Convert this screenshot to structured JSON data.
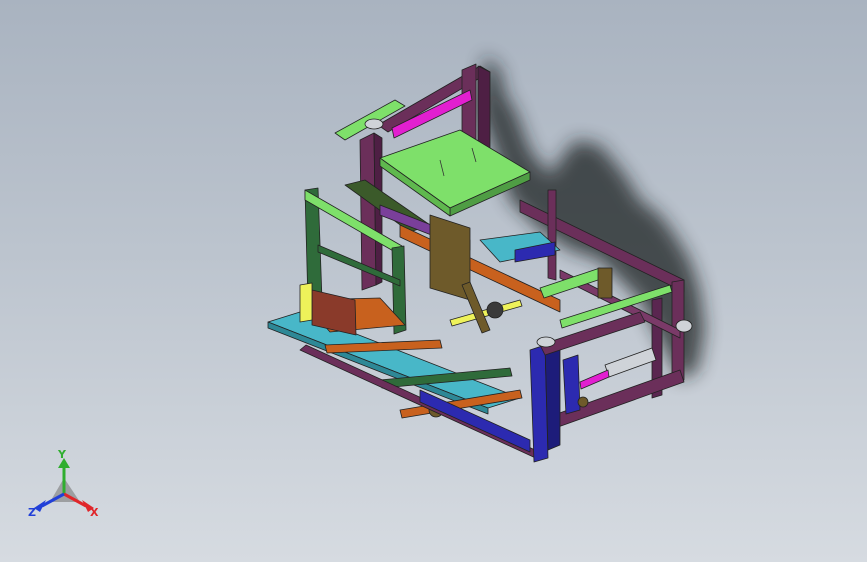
{
  "triad": {
    "x_label": "X",
    "y_label": "Y",
    "z_label": "Z",
    "colors": {
      "x": "#e0262a",
      "y": "#2fae2f",
      "z": "#2140d8"
    }
  },
  "model": {
    "part_colors": {
      "frame": "#6b2f5a",
      "plate_green": "#7ee06a",
      "magenta_bar": "#e21fd0",
      "blue_frame": "#2c2ab0",
      "orange_rail": "#c8611e",
      "yellow_bar": "#eef25a",
      "cyan_tray": "#48b7c8",
      "dark_green": "#2f6b3a",
      "purple_wall": "#7a3f9a",
      "olive_panel": "#6e5a2a"
    }
  }
}
